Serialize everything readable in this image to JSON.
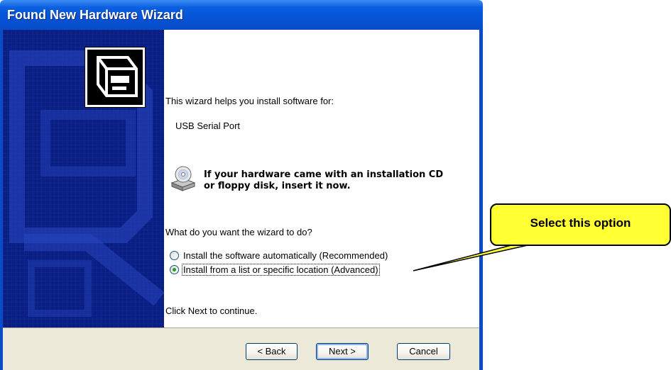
{
  "window": {
    "title": "Found New Hardware Wizard"
  },
  "content": {
    "intro": "This wizard helps you install software for:",
    "device_name": "USB Serial Port",
    "cd_hint_line1": "If your hardware came with an installation CD",
    "cd_hint_line2": "or floppy disk, insert it now.",
    "question": "What do you want the wizard to do?",
    "options": [
      {
        "label": "Install the software automatically (Recommended)",
        "selected": false
      },
      {
        "label": "Install from a list or specific location (Advanced)",
        "selected": true
      }
    ],
    "footer_text": "Click Next to continue."
  },
  "buttons": {
    "back": "< Back",
    "next": "Next >",
    "cancel": "Cancel"
  },
  "callout": {
    "text": "Select this option"
  },
  "icons": [
    "hardware-wizard-icon",
    "cd-drive-icon",
    "radio-unselected",
    "radio-selected"
  ],
  "colors": {
    "titlebar": "#0553d6",
    "banner": "#0b1f82",
    "callout": "#ffff33",
    "radio_dot": "#21a121"
  }
}
